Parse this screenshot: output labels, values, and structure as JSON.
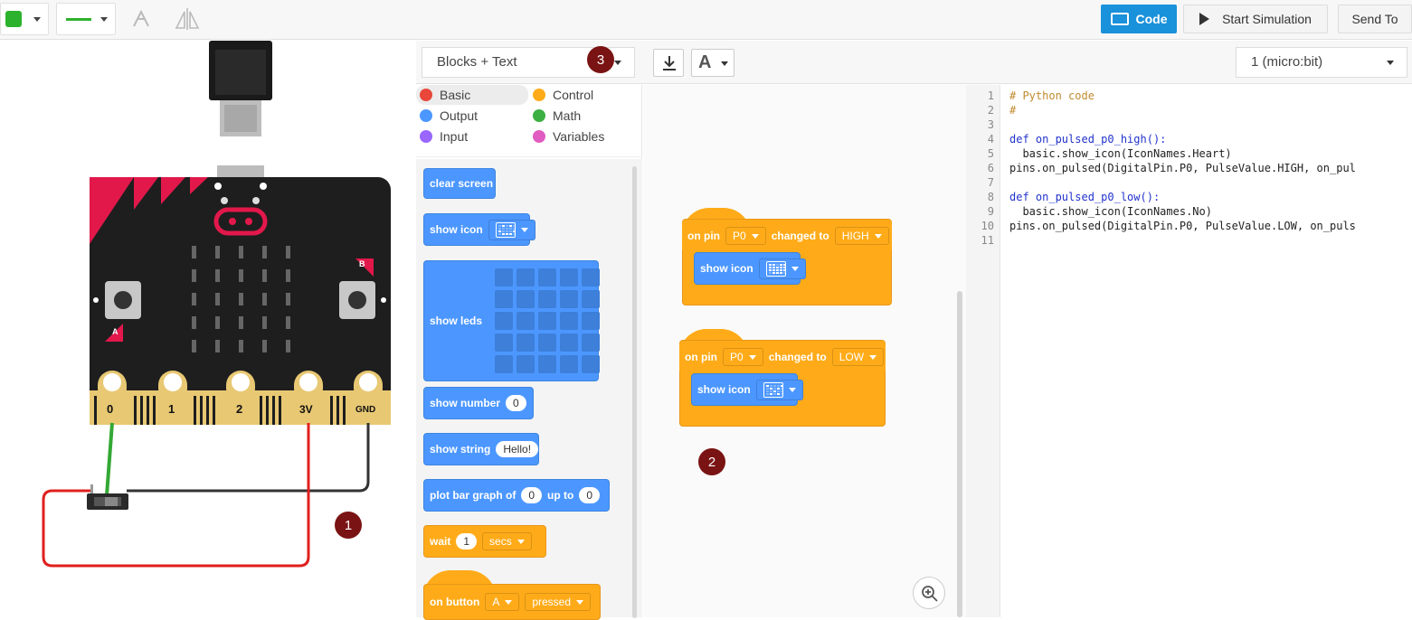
{
  "toolbar": {
    "code_label": "Code",
    "simulation_label": "Start Simulation",
    "send_label": "Send To",
    "color_value": "#2db22d"
  },
  "editor": {
    "mode": "Blocks + Text",
    "device": "1 (micro:bit)"
  },
  "categories": [
    {
      "label": "Basic",
      "color": "#e8473a"
    },
    {
      "label": "Control",
      "color": "#ffab19"
    },
    {
      "label": "Output",
      "color": "#4c97ff"
    },
    {
      "label": "Math",
      "color": "#3cb043"
    },
    {
      "label": "Input",
      "color": "#9966ff"
    },
    {
      "label": "Variables",
      "color": "#e05cc0"
    }
  ],
  "toolbox_blocks": {
    "clear_screen": "clear screen",
    "show_icon": "show icon",
    "show_leds": "show leds",
    "show_number": "show number",
    "show_number_value": "0",
    "show_string": "show string",
    "show_string_value": "Hello!",
    "plot_bar": "plot bar graph of",
    "plot_bar_value": "0",
    "plot_bar_up_to": "up to",
    "plot_bar_max": "0",
    "wait": "wait",
    "wait_value": "1",
    "wait_unit": "secs",
    "on_button": "on button",
    "on_button_key": "A",
    "on_button_action": "pressed"
  },
  "workspace": {
    "event1": {
      "on_pin": "on pin",
      "pin": "P0",
      "changed_to": "changed to",
      "value": "HIGH",
      "action": "show icon"
    },
    "event2": {
      "on_pin": "on pin",
      "pin": "P0",
      "changed_to": "changed to",
      "value": "LOW",
      "action": "show icon"
    }
  },
  "code_lines": [
    "# Python code",
    "#",
    "",
    "def on_pulsed_p0_high():",
    "  basic.show_icon(IconNames.Heart)",
    "pins.on_pulsed(DigitalPin.P0, PulseValue.HIGH, on_pul",
    "",
    "def on_pulsed_p0_low():",
    "  basic.show_icon(IconNames.No)",
    "pins.on_pulsed(DigitalPin.P0, PulseValue.LOW, on_puls",
    ""
  ],
  "line_numbers": [
    "1",
    "2",
    "3",
    "4",
    "5",
    "6",
    "7",
    "8",
    "9",
    "10",
    "11"
  ],
  "board": {
    "pins": [
      "0",
      "1",
      "2",
      "3V",
      "GND"
    ],
    "button_a": "A",
    "button_b": "B"
  },
  "badges": [
    "1",
    "2",
    "3"
  ]
}
